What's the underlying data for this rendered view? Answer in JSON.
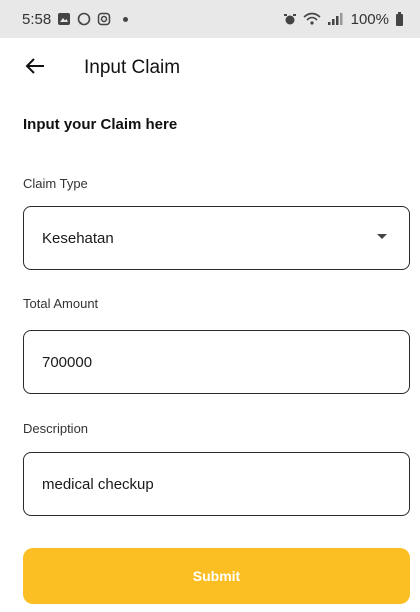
{
  "status_bar": {
    "time": "5:58",
    "battery": "100%",
    "left_icons": [
      "gallery-icon",
      "whatsapp-icon",
      "instagram-icon"
    ],
    "right_icons": [
      "alarm-icon",
      "wifi-icon",
      "signal-icon",
      "battery-icon"
    ]
  },
  "app_bar": {
    "title": "Input Claim"
  },
  "form": {
    "heading": "Input your Claim here",
    "claim_type_label": "Claim Type",
    "claim_type_value": "Kesehatan",
    "total_amount_label": "Total Amount",
    "total_amount_value": "700000",
    "description_label": "Description",
    "description_value": "medical checkup",
    "submit_label": "Submit"
  },
  "colors": {
    "accent": "#fbbf24",
    "status_bar_bg": "#e8e8e8",
    "border": "#2a2a2a"
  }
}
